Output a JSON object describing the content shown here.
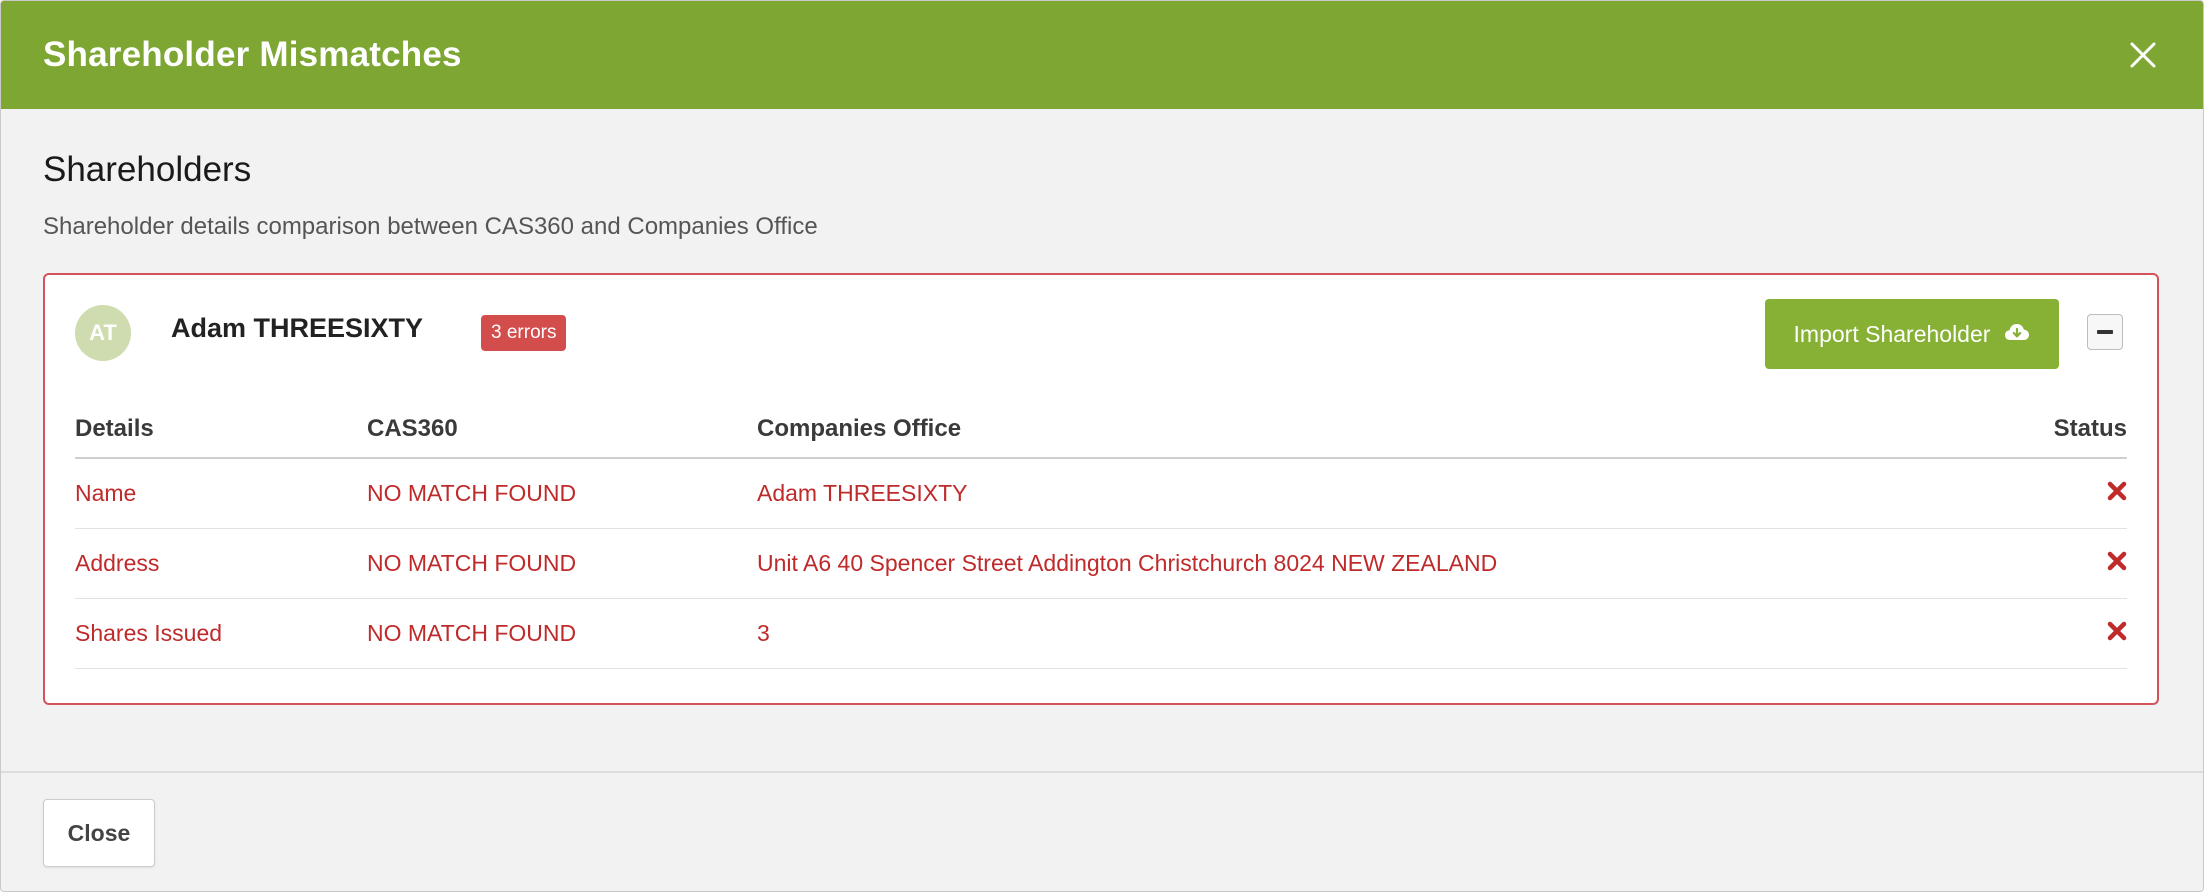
{
  "modal": {
    "title": "Shareholder Mismatches",
    "header_color": "#7ea632"
  },
  "section": {
    "title": "Shareholders",
    "subtitle": "Shareholder details comparison between CAS360 and Companies Office"
  },
  "shareholder": {
    "initials": "AT",
    "name": "Adam THREESIXTY",
    "error_badge": "3 errors",
    "import_label": "Import Shareholder",
    "import_icon": "cloud-download-icon",
    "collapse_icon": "minus-icon"
  },
  "table": {
    "headers": {
      "details": "Details",
      "cas360": "CAS360",
      "companies_office": "Companies Office",
      "status": "Status"
    },
    "rows": [
      {
        "details": "Name",
        "cas360": "NO MATCH FOUND",
        "companies_office": "Adam THREESIXTY",
        "status_icon": "error-x-icon"
      },
      {
        "details": "Address",
        "cas360": "NO MATCH FOUND",
        "companies_office": "Unit A6 40 Spencer Street Addington Christchurch 8024 NEW ZEALAND",
        "status_icon": "error-x-icon"
      },
      {
        "details": "Shares Issued",
        "cas360": "NO MATCH FOUND",
        "companies_office": "3",
        "status_icon": "error-x-icon"
      }
    ]
  },
  "footer": {
    "close_label": "Close"
  },
  "colors": {
    "accent": "#7ea632",
    "button_green": "#86b134",
    "error_red": "#bf2a2a",
    "badge_red": "#d44d4d"
  }
}
